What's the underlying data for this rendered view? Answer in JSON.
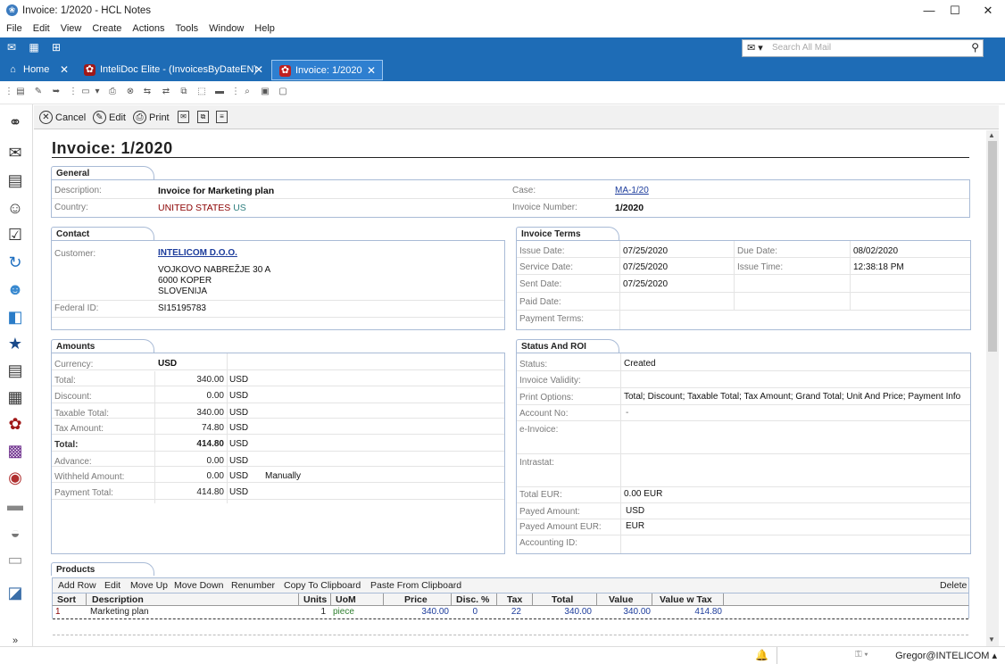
{
  "window": {
    "title": "Invoice: 1/2020 - HCL Notes",
    "minimize": "—",
    "maximize": "☐",
    "close": "✕"
  },
  "menu": [
    "File",
    "Edit",
    "View",
    "Create",
    "Actions",
    "Tools",
    "Window",
    "Help"
  ],
  "search": {
    "placeholder": "Search All Mail"
  },
  "tabs": [
    {
      "label": "Home",
      "icon": "home-icon"
    },
    {
      "label": "InteliDoc Elite - (InvoicesByDateEN)",
      "icon": "intelidoc-icon"
    },
    {
      "label": "Invoice: 1/2020",
      "icon": "invoice-icon"
    }
  ],
  "actions": {
    "cancel": "Cancel",
    "edit": "Edit",
    "print": "Print"
  },
  "doc": {
    "title": "Invoice: 1/2020"
  },
  "general": {
    "header": "General",
    "description_label": "Description:",
    "description": "Invoice for Marketing plan",
    "country_label": "Country:",
    "country_name": "UNITED STATES",
    "country_code": "US",
    "case_label": "Case:",
    "case": "MA-1/20",
    "invoice_number_label": "Invoice Number:",
    "invoice_number": "1/2020"
  },
  "contact": {
    "header": "Contact",
    "customer_label": "Customer:",
    "customer": "INTELICOM D.O.O.",
    "address1": "VOJKOVO NABREŽJE 30 A",
    "address2": "6000 KOPER",
    "address3": "SLOVENIJA",
    "federal_label": "Federal ID:",
    "federal": "SI15195783"
  },
  "terms": {
    "header": "Invoice Terms",
    "issue_label": "Issue Date:",
    "issue": "07/25/2020",
    "due_label": "Due Date:",
    "due": "08/02/2020",
    "service_label": "Service Date:",
    "service": "07/25/2020",
    "time_label": "Issue Time:",
    "time": "12:38:18 PM",
    "sent_label": "Sent Date:",
    "sent": "07/25/2020",
    "paid_label": "Paid Date:",
    "payment_label": "Payment Terms:"
  },
  "amounts": {
    "header": "Amounts",
    "currency_label": "Currency:",
    "currency": "USD",
    "rows": [
      {
        "label": "Total:",
        "value": "340.00",
        "cur": "USD",
        "note": ""
      },
      {
        "label": "Discount:",
        "value": "0.00",
        "cur": "USD",
        "note": ""
      },
      {
        "label": "Taxable Total:",
        "value": "340.00",
        "cur": "USD",
        "note": ""
      },
      {
        "label": "Tax Amount:",
        "value": "74.80",
        "cur": "USD",
        "note": ""
      },
      {
        "label": "Total:",
        "value": "414.80",
        "cur": "USD",
        "note": ""
      },
      {
        "label": "Advance:",
        "value": "0.00",
        "cur": "USD",
        "note": ""
      },
      {
        "label": "Withheld Amount:",
        "value": "0.00",
        "cur": "USD",
        "note": "Manually"
      },
      {
        "label": "Payment Total:",
        "value": "414.80",
        "cur": "USD",
        "note": ""
      }
    ]
  },
  "status": {
    "header": "Status And ROI",
    "status_label": "Status:",
    "status": "Created",
    "validity_label": "Invoice Validity:",
    "print_label": "Print Options:",
    "print": "Total; Discount; Taxable Total; Tax Amount; Grand Total; Unit And Price; Payment Info",
    "account_label": "Account No:",
    "account": "-",
    "einvoice_label": "e-Invoice:",
    "intrastat_label": "Intrastat:",
    "total_eur_label": "Total EUR:",
    "total_eur": "0.00 EUR",
    "payed_label": "Payed Amount:",
    "payed": "USD",
    "payed_eur_label": "Payed Amount EUR:",
    "payed_eur": "EUR",
    "accounting_label": "Accounting ID:"
  },
  "products": {
    "header": "Products",
    "toolbar": [
      "Add Row",
      "Edit",
      "Move Up",
      "Move Down",
      "Renumber",
      "Copy To Clipboard",
      "Paste From Clipboard"
    ],
    "delete": "Delete",
    "columns": [
      "Sort",
      "Description",
      "Units",
      "UoM",
      "Price",
      "Disc. %",
      "Tax",
      "Total",
      "Value",
      "Value w Tax"
    ],
    "row": {
      "sort": "1",
      "description": "Marketing plan",
      "units": "1",
      "uom": "piece",
      "price": "340.00",
      "disc": "0",
      "tax": "22",
      "total": "340.00",
      "value": "340.00",
      "value_tax": "414.80"
    }
  },
  "statusbar": {
    "user": "Gregor@INTELICOM ▴"
  }
}
